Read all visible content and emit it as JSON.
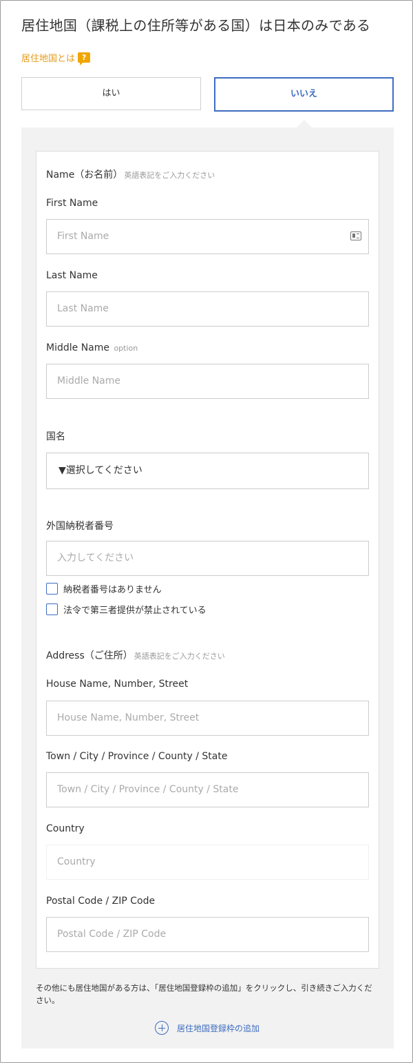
{
  "question": {
    "title": "居住地国（課税上の住所等がある国）は日本のみである",
    "help_link": "居住地国とは",
    "help_icon": "question-icon",
    "options": {
      "yes": "はい",
      "no": "いいえ"
    }
  },
  "name_section": {
    "heading": "Name（お名前）",
    "hint": "英語表記をご入力ください",
    "first_name": {
      "label": "First Name",
      "placeholder": "First Name"
    },
    "last_name": {
      "label": "Last Name",
      "placeholder": "Last Name"
    },
    "middle_name": {
      "label": "Middle Name",
      "optional": "option",
      "placeholder": "Middle Name"
    }
  },
  "country": {
    "label": "国名",
    "selected": "▼選択してください"
  },
  "tax_id": {
    "label": "外国納税者番号",
    "placeholder": "入力してください",
    "checkbox_none": "納税者番号はありません",
    "checkbox_prohibited": "法令で第三者提供が禁止されている"
  },
  "address_section": {
    "heading": "Address（ご住所）",
    "hint": "英語表記をご入力ください",
    "street": {
      "label": "House Name, Number, Street",
      "placeholder": "House Name, Number, Street"
    },
    "town": {
      "label": "Town / City / Province / County / State",
      "placeholder": "Town / City / Province / County / State"
    },
    "country": {
      "label": "Country",
      "placeholder": "Country"
    },
    "postal": {
      "label": "Postal Code / ZIP Code",
      "placeholder": "Postal Code / ZIP Code"
    }
  },
  "footer": {
    "note": "その他にも居住地国がある方は、「居住地国登録枠の追加」をクリックし、引き続きご入力ください。",
    "add_label": "居住地国登録枠の追加"
  },
  "colors": {
    "accent": "#3d6cc0",
    "help": "#e39b17",
    "panel": "#f2f2f2"
  }
}
